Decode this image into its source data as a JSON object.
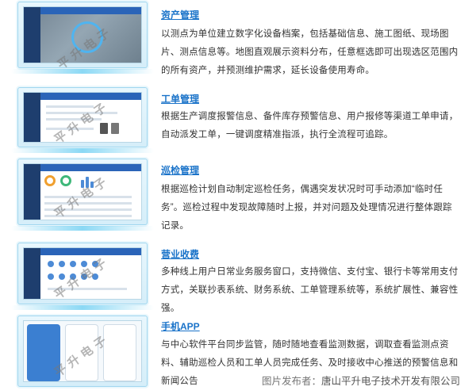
{
  "sections": [
    {
      "id": "assets",
      "title": "资产管理",
      "desc": "以测点为单位建立数字化设备档案，包括基础信息、施工图纸、现场图片、测点信息等。地图直观展示资料分布，任意框选即可出现选区范围内的所有资产，并预测维护需求，延长设备使用寿命。"
    },
    {
      "id": "workorder",
      "title": "工单管理",
      "desc": "根据生产调度报警信息、备件库存预警信息、用户报修等渠道工单申请，自动派发工单，一键调度精准指派，执行全流程可追踪。"
    },
    {
      "id": "inspection",
      "title": "巡检管理",
      "desc": "根据巡检计划自动制定巡检任务，偶遇突发状况时可手动添加“临时任务”。巡检过程中发现故障随时上报，并对问题及处理情况进行整体跟踪记录。"
    },
    {
      "id": "billing",
      "title": "营业收费",
      "desc": "多种线上用户日常业务服务窗口，支持微信、支付宝、银行卡等常用支付方式，关联抄表系统、财务系统、工单管理系统等，系统扩展性、兼容性强。"
    },
    {
      "id": "mobile",
      "title": "手机APP",
      "desc": "与中心软件平台同步监管，随时随地查看监测数据，调取查看监测点资料、辅助巡检人员和工单人员完成任务、及时接收中心推送的预警信息和新闻公告"
    }
  ],
  "watermark": "平 升 电 子",
  "caption": {
    "label": "图片发布者：",
    "value": "唐山平升电子技术开发有限公司"
  },
  "colors": {
    "title": "#1a73c9",
    "frame": "#9fd6ef",
    "glow": "#5ac8f0",
    "sidebar": "#1e3e6e",
    "topbar": "#2a64b8"
  }
}
